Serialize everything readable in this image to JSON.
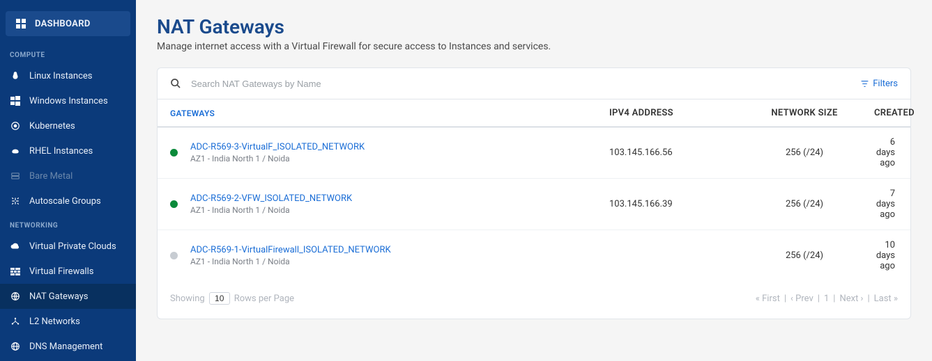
{
  "sidebar": {
    "dashboard": "DASHBOARD",
    "sections": {
      "compute": "COMPUTE",
      "networking": "NETWORKING"
    },
    "items": {
      "linux": "Linux Instances",
      "windows": "Windows Instances",
      "kubernetes": "Kubernetes",
      "rhel": "RHEL Instances",
      "baremetal": "Bare Metal",
      "autoscale": "Autoscale Groups",
      "vpc": "Virtual Private Clouds",
      "vfw": "Virtual Firewalls",
      "nat": "NAT Gateways",
      "l2": "L2 Networks",
      "dns": "DNS Management"
    }
  },
  "page": {
    "title": "NAT Gateways",
    "subtitle": "Manage internet access with a Virtual Firewall for secure access to Instances and services."
  },
  "search": {
    "placeholder": "Search NAT Gateways by Name",
    "filters_label": "Filters"
  },
  "table": {
    "headers": {
      "gateways": "GATEWAYS",
      "ipv4": "IPV4 ADDRESS",
      "network_size": "NETWORK SIZE",
      "created": "CREATED"
    },
    "rows": [
      {
        "status": "green",
        "name": "ADC-R569-3-VirtualF_ISOLATED_NETWORK",
        "location": "AZ1 - India North 1 / Noida",
        "ipv4": "103.145.166.56",
        "network_size": "256 (/24)",
        "created": "6 days ago"
      },
      {
        "status": "green",
        "name": "ADC-R569-2-VFW_ISOLATED_NETWORK",
        "location": "AZ1 - India North 1 / Noida",
        "ipv4": "103.145.166.39",
        "network_size": "256 (/24)",
        "created": "7 days ago"
      },
      {
        "status": "gray",
        "name": "ADC-R569-1-VirtualFirewall_ISOLATED_NETWORK",
        "location": "AZ1 - India North 1 / Noida",
        "ipv4": "",
        "network_size": "256 (/24)",
        "created": "10 days ago"
      }
    ]
  },
  "footer": {
    "showing": "Showing",
    "rpp_value": "10",
    "rpp_label": "Rows per Page",
    "first": "« First",
    "prev": "‹ Prev",
    "page": "1",
    "next": "Next ›",
    "last": "Last »"
  }
}
